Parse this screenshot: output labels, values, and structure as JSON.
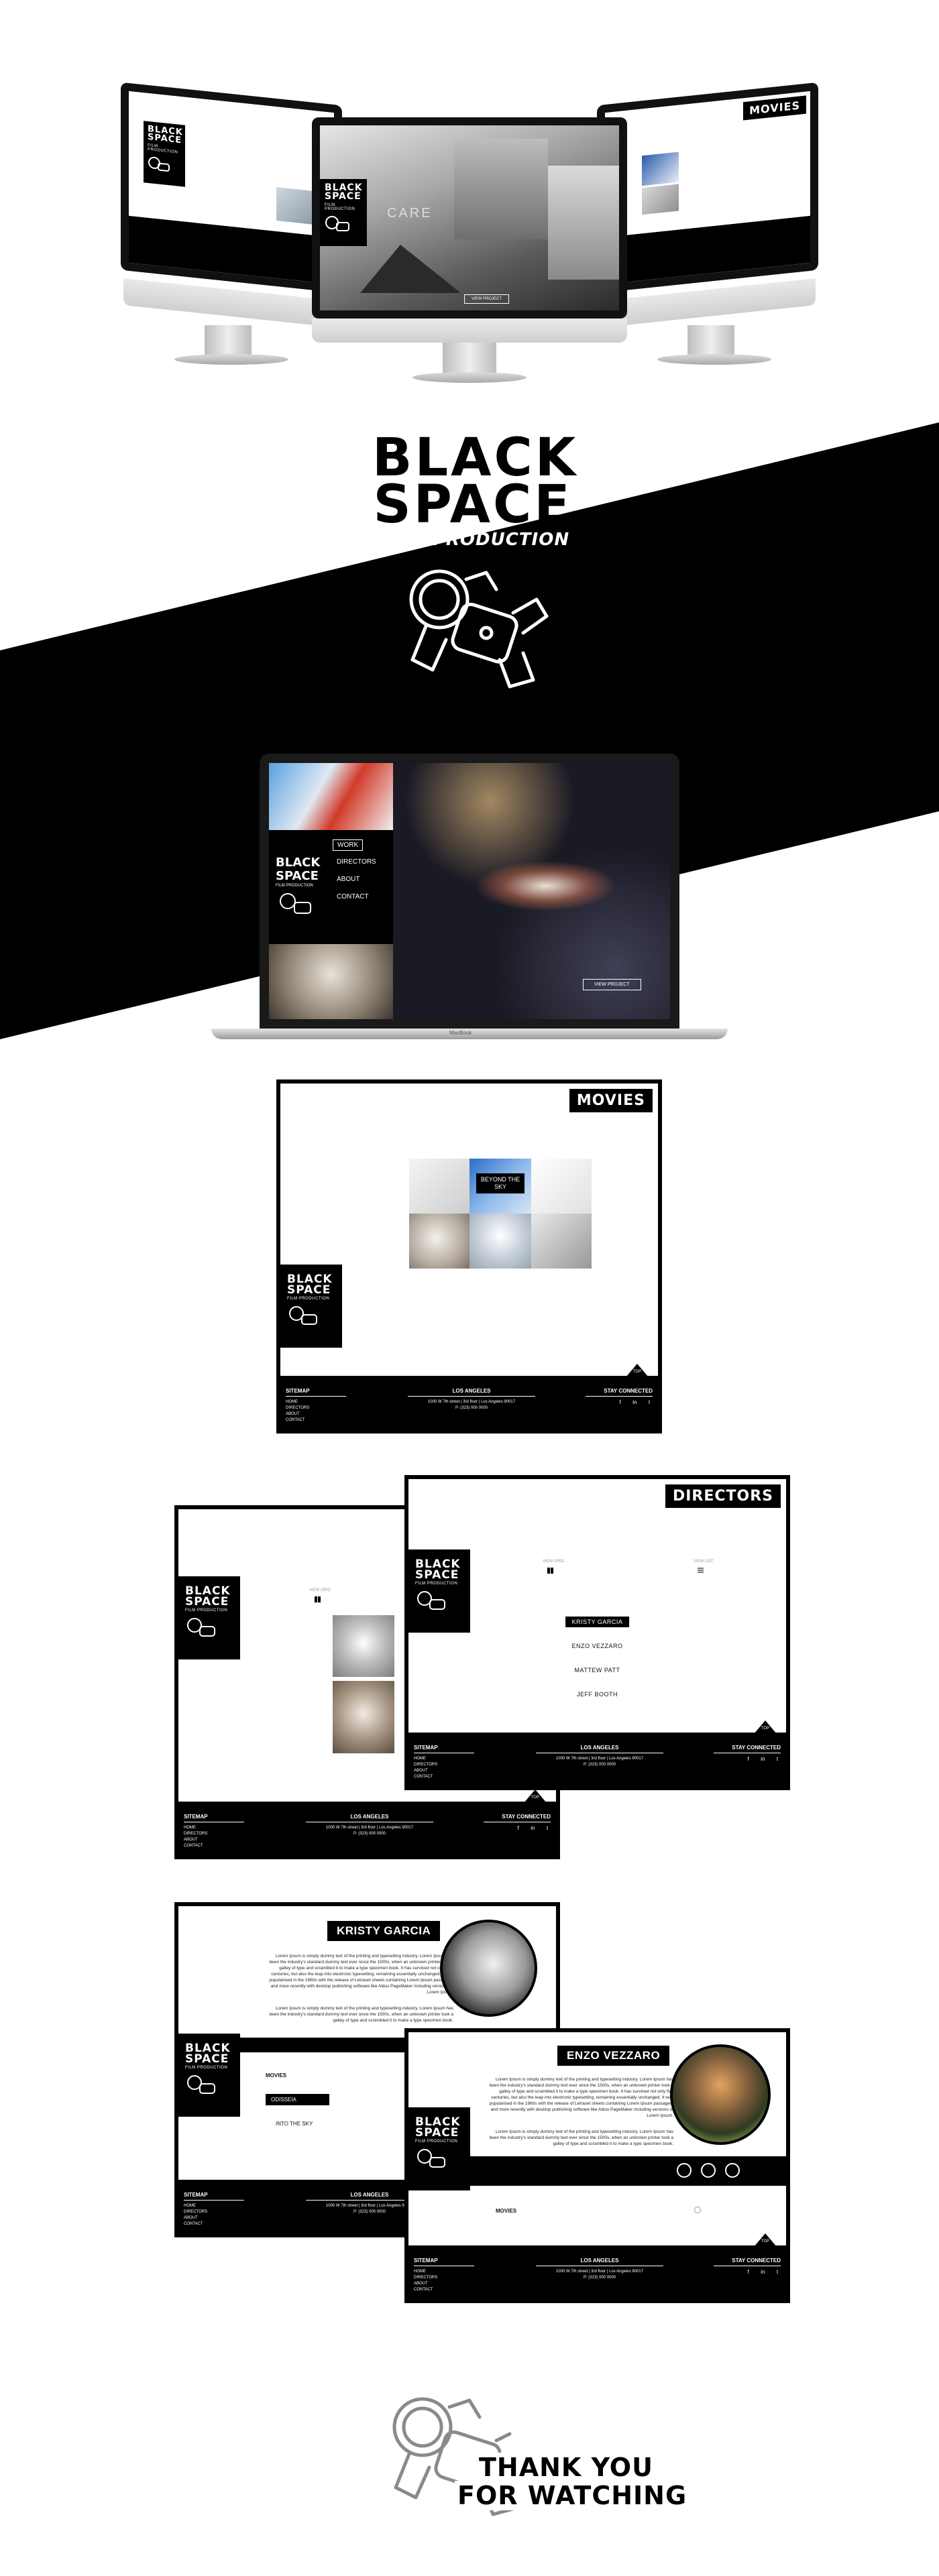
{
  "brand": {
    "line1": "BLACK",
    "line2": "SPACE",
    "tagline": "FILM PRODUCTION",
    "hero_tagline": "FILM PRODUCTION"
  },
  "monitors": {
    "left_title": "",
    "center_sign": "CARE",
    "center_button": "VIEW PROJECT",
    "right_title": "MOVIES"
  },
  "laptop": {
    "menu": [
      "WORK",
      "DIRECTORS",
      "ABOUT",
      "CONTACT"
    ],
    "view_button": "VIEW PROJECT",
    "label": "MacBook"
  },
  "movies_page": {
    "title": "MOVIES",
    "featured_label": "BEYOND THE SKY",
    "top_label": "TOP"
  },
  "footer": {
    "sitemap": "SITEMAP",
    "links": [
      "HOME",
      "DIRECTORS",
      "ABOUT",
      "CONTACT"
    ],
    "city": "LOS ANGELES",
    "address1": "1000 W 7th street  |  3rd floor  |  Los Angeles 90017",
    "address2": "P: (323) 000 0000",
    "stay": "STAY CONNECTED",
    "social": [
      "f",
      "in",
      "t"
    ]
  },
  "directors_page": {
    "title": "DIRECTORS",
    "view_grid": "VIEW GRID",
    "view_list": "VIEW LIST",
    "names": [
      "KRISTY GARCIA",
      "ENZO VEZZARO",
      "MATTEW PATT",
      "JEFF BOOTH"
    ]
  },
  "profile_kristy": {
    "name": "KRISTY GARCIA",
    "bio1": "Lorem Ipsum is simply dummy text of the printing and typesetting industry. Lorem Ipsum has been the industry's standard dummy text ever since the 1500s, when an unknown printer took a galley of type and scrambled it to make a type specimen book. It has survived not only five centuries, but also the leap into electronic typesetting, remaining essentially unchanged. It was popularised in the 1960s with the release of Letraset sheets containing Lorem Ipsum passages, and more recently with desktop publishing software like Aldus PageMaker including versions of Lorem Ipsum.",
    "bio2": "Lorem Ipsum is simply dummy text of the printing and typesetting industry. Lorem Ipsum has been the industry's standard dummy text ever since the 1500s, when an unknown printer took a galley of type and scrambled it to make a type specimen book.",
    "movies_label": "MOVIES",
    "movies": [
      "ODISSEIA",
      "INTO THE SKY"
    ]
  },
  "profile_enzo": {
    "name": "ENZO VEZZARO",
    "bio1": "Lorem Ipsum is simply dummy text of the printing and typesetting industry. Lorem Ipsum has been the industry's standard dummy text ever since the 1500s, when an unknown printer took a galley of type and scrambled it to make a type specimen book. It has survived not only five centuries, but also the leap into electronic typesetting, remaining essentially unchanged. It was popularised in the 1960s with the release of Letraset sheets containing Lorem Ipsum passages, and more recently with desktop publishing software like Aldus PageMaker including versions of Lorem Ipsum.",
    "bio2": "Lorem Ipsum is simply dummy text of the printing and typesetting industry. Lorem Ipsum has been the industry's standard dummy text ever since the 1500s, when an unknown printer took a galley of type and scrambled it to make a type specimen book.",
    "movies_label": "MOVIES"
  },
  "closing": {
    "line1": "THANK YOU",
    "line2": "FOR WATCHING"
  },
  "colors": {
    "black": "#000000",
    "white": "#ffffff",
    "gray": "#9a9a9a"
  }
}
